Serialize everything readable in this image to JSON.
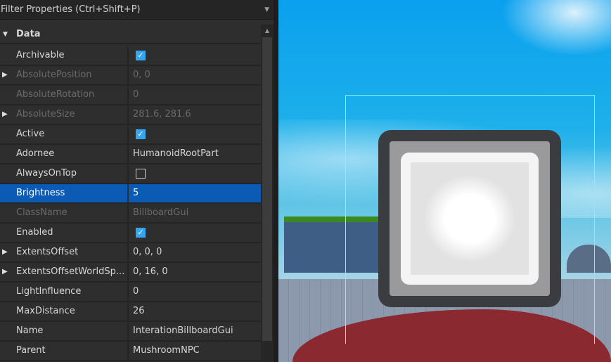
{
  "filter": {
    "placeholder": "Filter Properties (Ctrl+Shift+P)"
  },
  "section": {
    "label": "Data"
  },
  "properties": [
    {
      "name": "Archivable",
      "value": "",
      "type": "checkbox",
      "checked": true,
      "readonly": false,
      "expandable": false
    },
    {
      "name": "AbsolutePosition",
      "value": "0, 0",
      "type": "text",
      "readonly": true,
      "expandable": true
    },
    {
      "name": "AbsoluteRotation",
      "value": "0",
      "type": "text",
      "readonly": true,
      "expandable": false
    },
    {
      "name": "AbsoluteSize",
      "value": "281.6, 281.6",
      "type": "text",
      "readonly": true,
      "expandable": true
    },
    {
      "name": "Active",
      "value": "",
      "type": "checkbox",
      "checked": true,
      "readonly": false,
      "expandable": false
    },
    {
      "name": "Adornee",
      "value": "HumanoidRootPart",
      "type": "text",
      "readonly": false,
      "expandable": false
    },
    {
      "name": "AlwaysOnTop",
      "value": "",
      "type": "checkbox",
      "checked": false,
      "readonly": false,
      "expandable": false
    },
    {
      "name": "Brightness",
      "value": "5",
      "type": "text",
      "readonly": false,
      "expandable": false,
      "selected": true
    },
    {
      "name": "ClassName",
      "value": "BillboardGui",
      "type": "text",
      "readonly": true,
      "expandable": false
    },
    {
      "name": "Enabled",
      "value": "",
      "type": "checkbox",
      "checked": true,
      "readonly": false,
      "expandable": false
    },
    {
      "name": "ExtentsOffset",
      "value": "0, 0, 0",
      "type": "text",
      "readonly": false,
      "expandable": true
    },
    {
      "name": "ExtentsOffsetWorldSp...",
      "value": "0, 16, 0",
      "type": "text",
      "readonly": false,
      "expandable": true
    },
    {
      "name": "LightInfluence",
      "value": "0",
      "type": "text",
      "readonly": false,
      "expandable": false
    },
    {
      "name": "MaxDistance",
      "value": "26",
      "type": "text",
      "readonly": false,
      "expandable": false
    },
    {
      "name": "Name",
      "value": "InterationBillboardGui",
      "type": "text",
      "readonly": false,
      "expandable": false
    },
    {
      "name": "Parent",
      "value": "MushroomNPC",
      "type": "text",
      "readonly": false,
      "expandable": false
    }
  ],
  "colors": {
    "selection": "#0b5bb5",
    "checkbox": "#35a5f0",
    "selection_box": "#7ff0ff"
  }
}
